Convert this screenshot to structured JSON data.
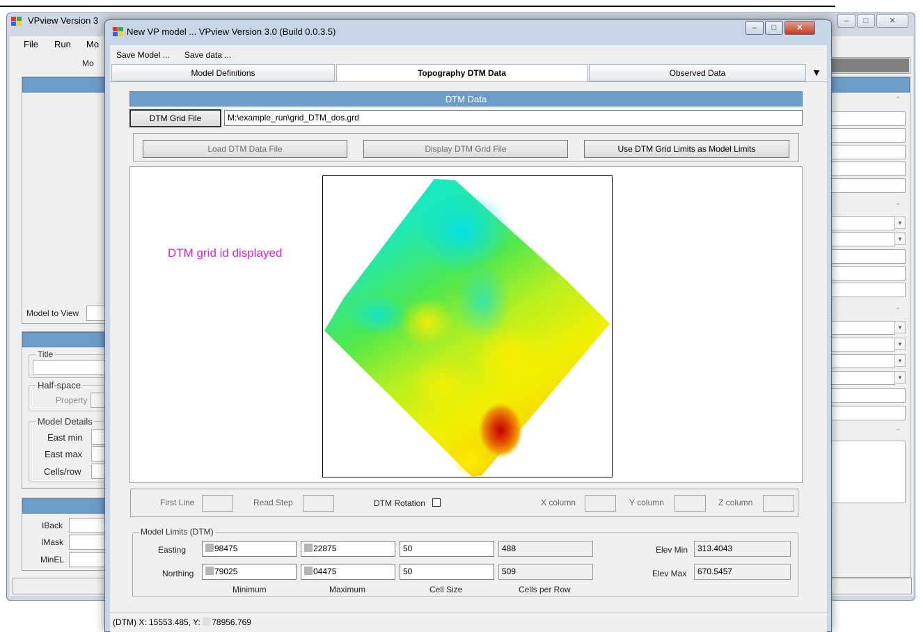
{
  "background_window": {
    "title": "VPview Version 3",
    "menu": [
      "File",
      "Run",
      "Mo"
    ],
    "partial_header": "Mo",
    "model_to_view_label": "Model to View",
    "title_group": "Title",
    "halfspace_group": "Half-space",
    "property_label": "Property",
    "model_details_group": "Model Details",
    "east_min_label": "East min",
    "east_max_label": "East max",
    "cells_row_label": "Cells/row",
    "iback_label": "IBack",
    "imask_label": "IMask",
    "minel_label": "MinEL"
  },
  "front_window": {
    "title": "New VP model ... VPview Version 3.0 (Build 0.0.3.5)",
    "menu": [
      "Save Model ...",
      "Save data ..."
    ],
    "tabs": [
      {
        "label": "Model Definitions",
        "active": false
      },
      {
        "label": "Topography DTM Data",
        "active": true
      },
      {
        "label": "Observed Data",
        "active": false
      }
    ],
    "section_header": "DTM Data",
    "dtm_grid_button": "DTM Grid File",
    "dtm_grid_path": "M:\\example_run\\grid_DTM_dos.grd",
    "buttons": {
      "load": "Load DTM Data File",
      "display": "Display DTM Grid File",
      "use_limits": "Use DTM Grid Limits as Model Limits"
    },
    "display_message": "DTM grid id displayed",
    "read_options": {
      "first_line": "First Line",
      "read_step": "Read Step",
      "dtm_rotation": "DTM Rotation",
      "x_column": "X column",
      "y_column": "Y column",
      "z_column": "Z column"
    },
    "model_limits": {
      "group_label": "Model Limits (DTM)",
      "easting_label": "Easting",
      "northing_label": "Northing",
      "easting": {
        "minimum": "98475",
        "maximum": "22875",
        "cell_size": "50",
        "cells_per_row": "488"
      },
      "northing": {
        "minimum": "79025",
        "maximum": "04475",
        "cell_size": "50",
        "cells_per_row": "509"
      },
      "col_minimum": "Minimum",
      "col_maximum": "Maximum",
      "col_cell_size": "Cell Size",
      "col_cells_per_row": "Cells per Row",
      "elev_min_label": "Elev Min",
      "elev_min": "313.4043",
      "elev_max_label": "Elev Max",
      "elev_max": "670.5457"
    },
    "status": {
      "prefix": "(DTM) X:",
      "x": "15553.485,",
      "y_label": "Y:",
      "y": "78956.769"
    }
  },
  "colors": {
    "accent_blue": "#6d9cc9",
    "label_magenta": "#dd22cc",
    "dtm_low": "#00e5ff",
    "dtm_high": "#cc1100"
  }
}
